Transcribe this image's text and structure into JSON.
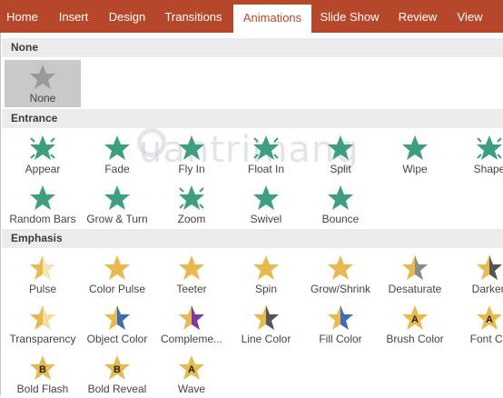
{
  "ribbon": {
    "tabs": [
      {
        "label": "Home"
      },
      {
        "label": "Insert"
      },
      {
        "label": "Design"
      },
      {
        "label": "Transitions"
      },
      {
        "label": "Animations",
        "active": true
      },
      {
        "label": "Slide Show"
      },
      {
        "label": "Review"
      },
      {
        "label": "View"
      }
    ]
  },
  "watermark": "uantrimang",
  "sections": {
    "none": {
      "title": "None",
      "items": [
        {
          "label": "None",
          "icon": "star-gray-icon",
          "selected": true
        }
      ]
    },
    "entrance": {
      "title": "Entrance",
      "color": "#3e9e80",
      "items": [
        {
          "label": "Appear",
          "icon": "appear-star-icon"
        },
        {
          "label": "Fade",
          "icon": "fade-star-icon"
        },
        {
          "label": "Fly In",
          "icon": "fly-in-star-icon"
        },
        {
          "label": "Float In",
          "icon": "float-in-star-icon"
        },
        {
          "label": "Split",
          "icon": "split-star-icon"
        },
        {
          "label": "Wipe",
          "icon": "wipe-star-icon"
        },
        {
          "label": "Shape",
          "icon": "shape-star-icon"
        },
        {
          "label": "Random Bars",
          "icon": "random-bars-star-icon"
        },
        {
          "label": "Grow & Turn",
          "icon": "grow-turn-star-icon"
        },
        {
          "label": "Zoom",
          "icon": "zoom-star-icon"
        },
        {
          "label": "Swivel",
          "icon": "swivel-star-icon"
        },
        {
          "label": "Bounce",
          "icon": "bounce-star-icon"
        }
      ]
    },
    "emphasis": {
      "title": "Emphasis",
      "color": "#e8b94f",
      "items": [
        {
          "label": "Pulse",
          "icon": "pulse-star-icon"
        },
        {
          "label": "Color Pulse",
          "icon": "color-pulse-star-icon"
        },
        {
          "label": "Teeter",
          "icon": "teeter-star-icon"
        },
        {
          "label": "Spin",
          "icon": "spin-star-icon"
        },
        {
          "label": "Grow/Shrink",
          "icon": "grow-shrink-star-icon"
        },
        {
          "label": "Desaturate",
          "icon": "desaturate-star-icon"
        },
        {
          "label": "Darken",
          "icon": "darken-star-icon"
        },
        {
          "label": "Transparency",
          "icon": "transparency-star-icon"
        },
        {
          "label": "Object Color",
          "icon": "object-color-star-icon"
        },
        {
          "label": "Compleme...",
          "icon": "complementary-color-star-icon"
        },
        {
          "label": "Line Color",
          "icon": "line-color-star-icon"
        },
        {
          "label": "Fill Color",
          "icon": "fill-color-star-icon"
        },
        {
          "label": "Brush Color",
          "icon": "brush-color-star-icon",
          "letter": "A"
        },
        {
          "label": "Font Co",
          "icon": "font-color-star-icon",
          "letter": "A"
        },
        {
          "label": "Bold Flash",
          "icon": "bold-flash-star-icon",
          "letter": "B"
        },
        {
          "label": "Bold Reveal",
          "icon": "bold-reveal-star-icon",
          "letter": "B"
        },
        {
          "label": "Wave",
          "icon": "wave-star-icon",
          "letter": "A"
        }
      ]
    }
  }
}
